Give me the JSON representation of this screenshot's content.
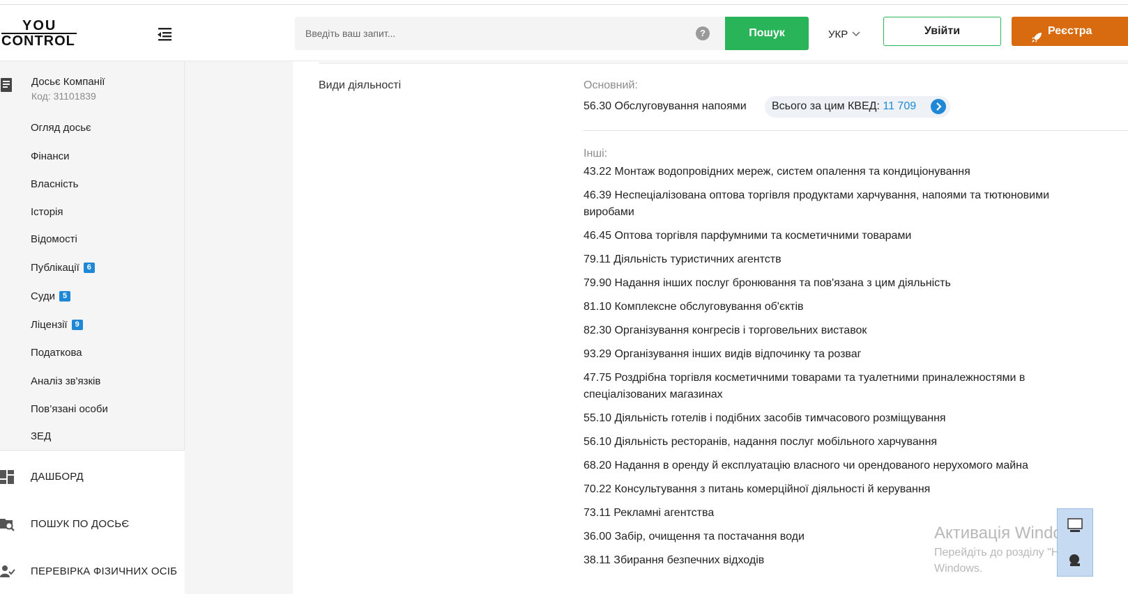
{
  "logo": {
    "line1": "YOU",
    "line2": "CONTROL"
  },
  "icons": {
    "menu_toggle": "indent-left-icon",
    "dossier": "document-icon",
    "help": "question-circle-icon",
    "lang_chevron": "chevron-down-icon",
    "register": "rocket-icon",
    "kved_arrow": "chevron-right-circle-icon"
  },
  "colors": {
    "search_button": "#2ab45a",
    "register_button": "#d86a0f",
    "link_blue": "#1e88d6"
  },
  "sidebar": {
    "dossier": {
      "title": "Досьє Компанії",
      "code": "Код: 31101839"
    },
    "items": [
      {
        "label": "Огляд досьє"
      },
      {
        "label": "Фінанси"
      },
      {
        "label": "Власність"
      },
      {
        "label": "Історія"
      },
      {
        "label": "Відомості"
      },
      {
        "label": "Публікації",
        "badge": "6"
      },
      {
        "label": "Суди",
        "badge": "5"
      },
      {
        "label": "Ліцензії",
        "badge": "9"
      },
      {
        "label": "Податкова"
      },
      {
        "label": "Аналіз зв'язків"
      },
      {
        "label": "Пов’язані особи"
      },
      {
        "label": "ЗЕД"
      }
    ],
    "main_nav": [
      {
        "label": "ДАШБОРД",
        "icon": "dashboard-icon"
      },
      {
        "label": "ПОШУК ПО ДОСЬЄ",
        "icon": "folder-search-icon"
      },
      {
        "label": "ПЕРЕВІРКА ФІЗИЧНИХ ОСІБ",
        "icon": "user-check-icon"
      }
    ]
  },
  "header": {
    "search_placeholder": "Введіть ваш запит...",
    "help_glyph": "?",
    "search_button": "Пошук",
    "language": "УКР",
    "login_button": "Увійти",
    "register_button": "Реєстра"
  },
  "section": {
    "label": "Види діяльності",
    "main_label": "Основний:",
    "main_kved": "56.30 Обслуговування напоями",
    "kved_total_label": "Всього за цим КВЕД:",
    "kved_total_count": "11 709",
    "other_label": "Інші:",
    "others": [
      "43.22 Монтаж водопровідних мереж, систем опалення та кондиціонування",
      "46.39 Неспеціалізована оптова торгівля продуктами харчування, напоями та тютюновими виробами",
      "46.45 Оптова торгівля парфумними та косметичними товарами",
      "79.11 Діяльність туристичних агентств",
      "79.90 Надання інших послуг бронювання та пов'язана з цим діяльність",
      "81.10 Комплексне обслуговування об'єктів",
      "82.30 Організування конгресів і торговельних виставок",
      "93.29 Організування інших видів відпочинку та розваг",
      "47.75 Роздрібна торгівля косметичними товарами та туалетними приналежностями в спеціалізованих магазинах",
      "55.10 Діяльність готелів і подібних засобів тимчасового розміщування",
      "56.10 Діяльність ресторанів, надання послуг мобільного харчування",
      "68.20 Надання в оренду й експлуатацію власного чи орендованого нерухомого майна",
      "70.22 Консультування з питань комерційної діяльності й керування",
      "73.11 Рекламні агентства",
      "36.00 Забір, очищення та постачання води",
      "38.11 Збирання безпечних відходів"
    ]
  },
  "os_overlay": {
    "line1": "Активація Windows",
    "line2": "Перейдіть до розділу \"Настр",
    "line3": "Windows."
  }
}
